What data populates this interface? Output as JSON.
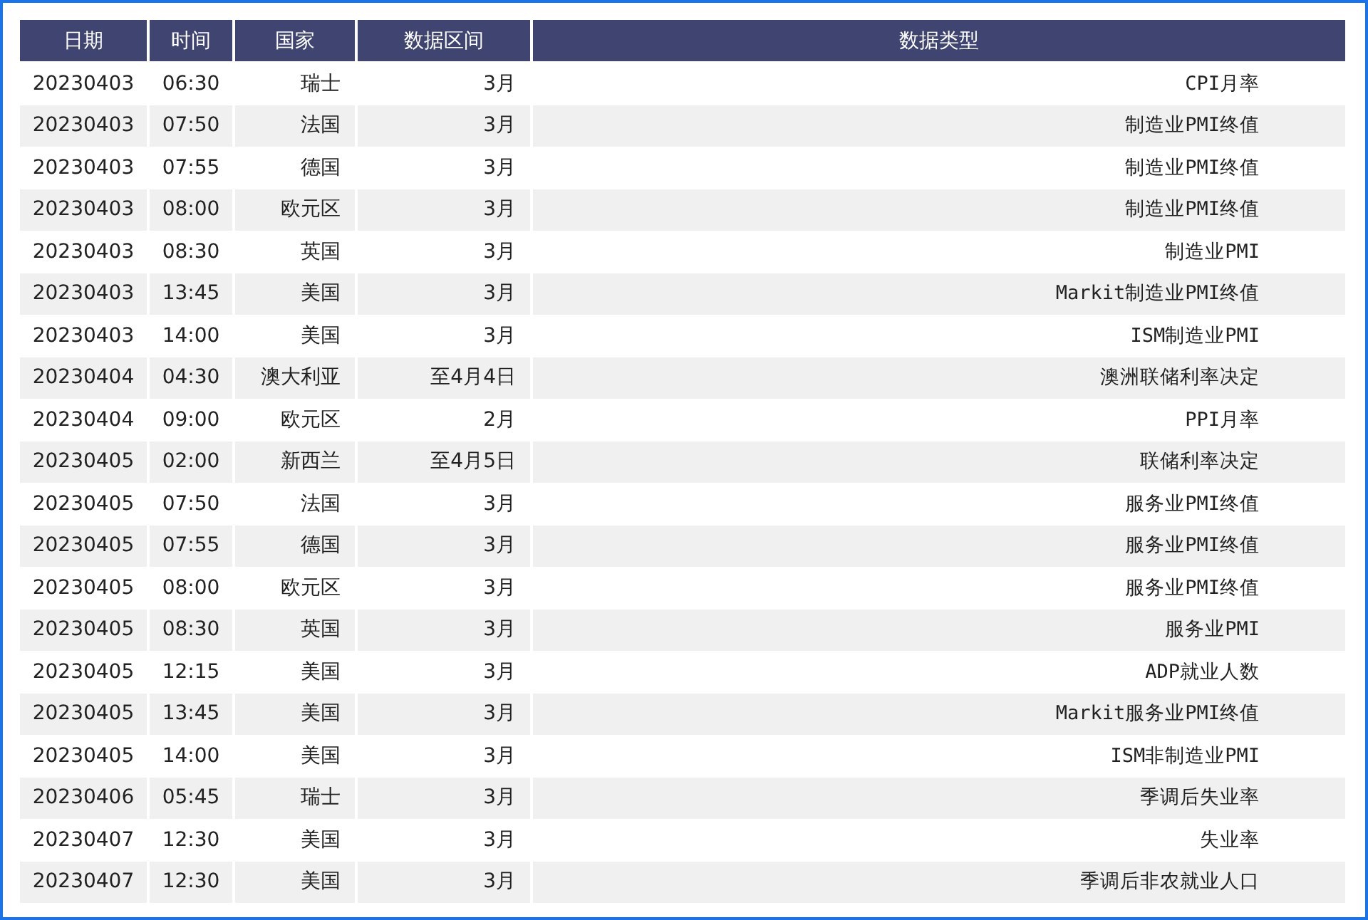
{
  "table": {
    "columns": [
      "日期",
      "时间",
      "国家",
      "数据区间",
      "数据类型"
    ],
    "rows": [
      [
        "20230403",
        "06:30",
        "瑞士",
        "3月",
        "CPI月率"
      ],
      [
        "20230403",
        "07:50",
        "法国",
        "3月",
        "制造业PMI终值"
      ],
      [
        "20230403",
        "07:55",
        "德国",
        "3月",
        "制造业PMI终值"
      ],
      [
        "20230403",
        "08:00",
        "欧元区",
        "3月",
        "制造业PMI终值"
      ],
      [
        "20230403",
        "08:30",
        "英国",
        "3月",
        "制造业PMI"
      ],
      [
        "20230403",
        "13:45",
        "美国",
        "3月",
        "Markit制造业PMI终值"
      ],
      [
        "20230403",
        "14:00",
        "美国",
        "3月",
        "ISM制造业PMI"
      ],
      [
        "20230404",
        "04:30",
        "澳大利亚",
        "至4月4日",
        "澳洲联储利率决定"
      ],
      [
        "20230404",
        "09:00",
        "欧元区",
        "2月",
        "PPI月率"
      ],
      [
        "20230405",
        "02:00",
        "新西兰",
        "至4月5日",
        "联储利率决定"
      ],
      [
        "20230405",
        "07:50",
        "法国",
        "3月",
        "服务业PMI终值"
      ],
      [
        "20230405",
        "07:55",
        "德国",
        "3月",
        "服务业PMI终值"
      ],
      [
        "20230405",
        "08:00",
        "欧元区",
        "3月",
        "服务业PMI终值"
      ],
      [
        "20230405",
        "08:30",
        "英国",
        "3月",
        "服务业PMI"
      ],
      [
        "20230405",
        "12:15",
        "美国",
        "3月",
        "ADP就业人数"
      ],
      [
        "20230405",
        "13:45",
        "美国",
        "3月",
        "Markit服务业PMI终值"
      ],
      [
        "20230405",
        "14:00",
        "美国",
        "3月",
        "ISM非制造业PMI"
      ],
      [
        "20230406",
        "05:45",
        "瑞士",
        "3月",
        "季调后失业率"
      ],
      [
        "20230407",
        "12:30",
        "美国",
        "3月",
        "失业率"
      ],
      [
        "20230407",
        "12:30",
        "美国",
        "3月",
        "季调后非农就业人口"
      ]
    ]
  }
}
